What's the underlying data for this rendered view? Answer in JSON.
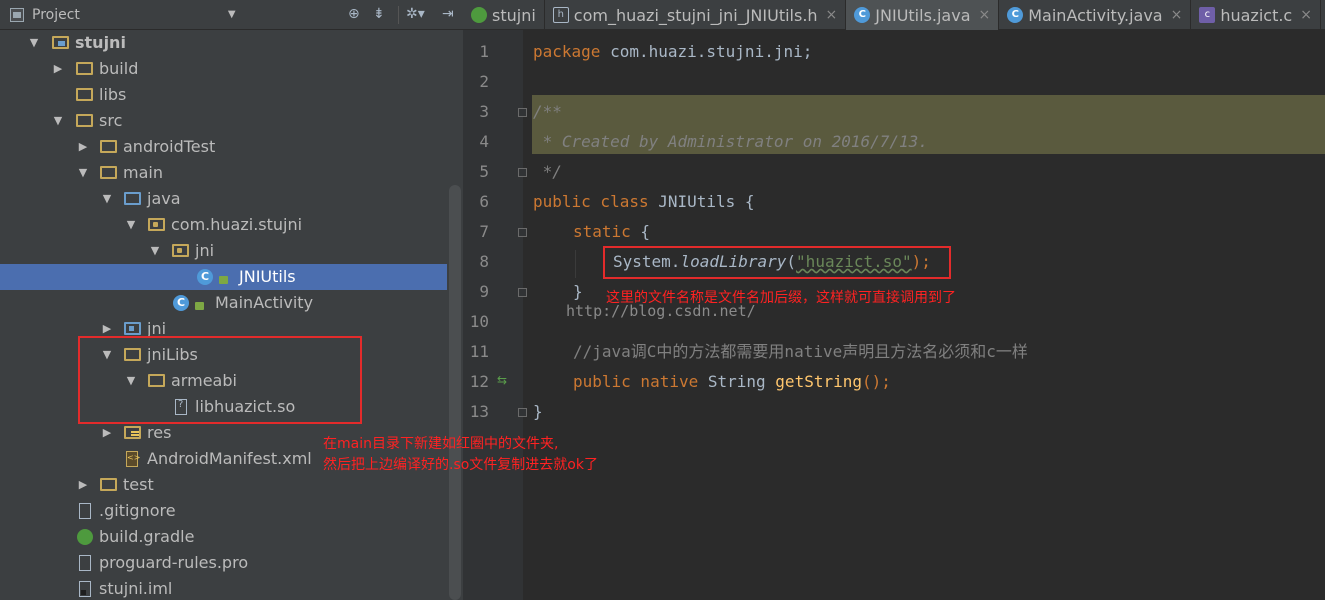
{
  "project_panel": {
    "title": "Project",
    "tree": [
      {
        "label": "stujni",
        "icon": "module-folder-icon",
        "expanded": true
      },
      {
        "label": "build",
        "icon": "folder-icon",
        "expanded": false
      },
      {
        "label": "libs",
        "icon": "folder-icon"
      },
      {
        "label": "src",
        "icon": "folder-icon",
        "expanded": true
      },
      {
        "label": "androidTest",
        "icon": "folder-icon",
        "expanded": false
      },
      {
        "label": "main",
        "icon": "folder-icon",
        "expanded": true
      },
      {
        "label": "java",
        "icon": "source-folder-icon",
        "expanded": true
      },
      {
        "label": "com.huazi.stujni",
        "icon": "package-icon",
        "expanded": true
      },
      {
        "label": "jni",
        "icon": "package-icon",
        "expanded": true
      },
      {
        "label": "JNIUtils",
        "icon": "class-icon",
        "selected": true
      },
      {
        "label": "MainActivity",
        "icon": "class-icon"
      },
      {
        "label": "jni",
        "icon": "source-folder-icon",
        "expanded": false
      },
      {
        "label": "jniLibs",
        "icon": "folder-icon",
        "expanded": true
      },
      {
        "label": "armeabi",
        "icon": "folder-icon",
        "expanded": true
      },
      {
        "label": "libhuazict.so",
        "icon": "unknown-file-icon"
      },
      {
        "label": "res",
        "icon": "resource-folder-icon",
        "expanded": false
      },
      {
        "label": "AndroidManifest.xml",
        "icon": "xml-file-icon"
      },
      {
        "label": "test",
        "icon": "folder-icon",
        "expanded": false
      },
      {
        "label": ".gitignore",
        "icon": "text-file-icon"
      },
      {
        "label": "build.gradle",
        "icon": "gradle-icon"
      },
      {
        "label": "proguard-rules.pro",
        "icon": "text-file-icon"
      },
      {
        "label": "stujni.iml",
        "icon": "iml-file-icon"
      }
    ]
  },
  "editor": {
    "tabs": [
      {
        "label": "stujni",
        "icon": "android-icon",
        "active": false,
        "closable": false
      },
      {
        "label": "com_huazi_stujni_jni_JNIUtils.h",
        "icon": "header-file-icon",
        "active": false,
        "closable": true
      },
      {
        "label": "JNIUtils.java",
        "icon": "class-icon",
        "active": true,
        "closable": true
      },
      {
        "label": "MainActivity.java",
        "icon": "class-icon",
        "active": false,
        "closable": true
      },
      {
        "label": "huazict.c",
        "icon": "c-file-icon",
        "active": false,
        "closable": true
      }
    ],
    "tab_close_glyph": "×",
    "line_numbers": [
      "1",
      "2",
      "3",
      "4",
      "5",
      "6",
      "7",
      "8",
      "9",
      "10",
      "11",
      "12",
      "13"
    ],
    "code": {
      "l1_kw": "package",
      "l1_rest": " com.huazi.stujni.jni;",
      "l3": "/**",
      "l4": " * Created by Administrator on 2016/7/13.",
      "l5": " */",
      "l6_kw1": "public",
      "l6_kw2": " class",
      "l6_rest": " JNIUtils {",
      "l7_kw": "static",
      "l7_rest": " {",
      "l8_a": "System.",
      "l8_m": "loadLibrary",
      "l8_b": "(",
      "l8_s": "\"huazict.so\"",
      "l8_c": ");",
      "l9": "}",
      "l11": "//java调C中的方法都需要用native声明且方法名必须和c一样",
      "l12_kw1": "public",
      "l12_kw2": " native",
      "l12_t": " String ",
      "l12_m": "getString",
      "l12_rest": "();",
      "l13": "}"
    }
  },
  "annotations": {
    "code_note": "这里的文件名称是文件名加后缀，这样就可直接调用到了",
    "tree_note_1": "在main目录下新建如红圈中的文件夹,",
    "tree_note_2": "然后把上边编译好的.so文件复制进去就ok了",
    "watermark": "http://blog.csdn.net/",
    "accent_color": "#e32b2b"
  }
}
